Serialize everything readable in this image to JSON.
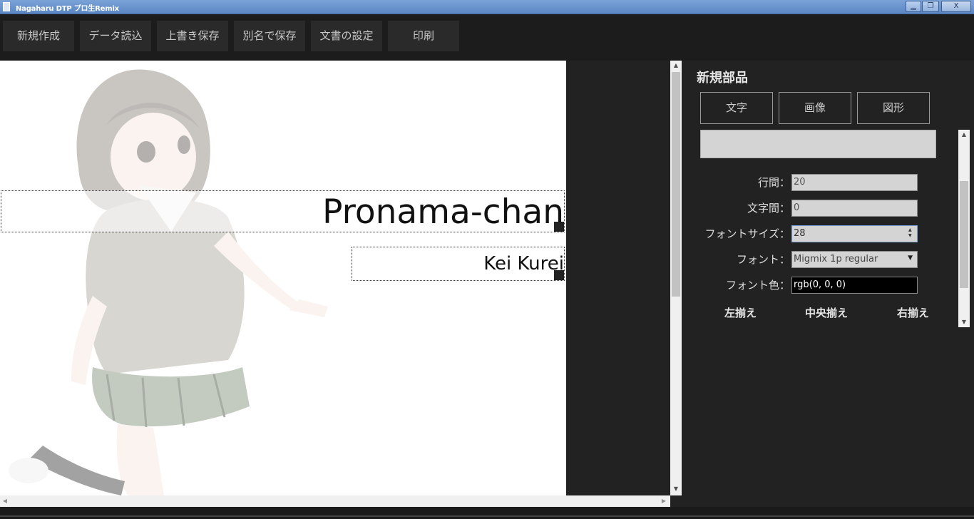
{
  "window": {
    "title": "Nagaharu DTP プロ生Remix",
    "minimize_glyph": "▁",
    "maximize_glyph": "❐",
    "close_glyph": "X"
  },
  "toolbar": {
    "new": "新規作成",
    "load": "データ読込",
    "save": "上書き保存",
    "save_as": "別名で保存",
    "doc_settings": "文書の設定",
    "print": "印刷"
  },
  "canvas": {
    "title_text": "Pronama-chan",
    "author_text": "Kei Kurei",
    "background_illustration": "character-illustration"
  },
  "panel": {
    "heading": "新規部品",
    "part_buttons": {
      "text": "文字",
      "image": "画像",
      "shape": "図形"
    },
    "textarea_value": "",
    "line_height_label": "行間：",
    "line_height_value": "20",
    "letter_spacing_label": "文字間：",
    "letter_spacing_value": "0",
    "font_size_label": "フォントサイズ：",
    "font_size_value": "28",
    "font_label": "フォント：",
    "font_value": "Migmix 1p regular",
    "font_color_label": "フォント色：",
    "font_color_value": "rgb(0, 0, 0)",
    "align_left": "左揃え",
    "align_center": "中央揃え",
    "align_right": "右揃え"
  },
  "colors": {
    "titlebar": "#6b96cf",
    "toolbar_bg": "#1c1c1c",
    "button_bg": "#2a2a2a",
    "panel_bg": "#222222",
    "input_bg": "#d4d4d4"
  }
}
